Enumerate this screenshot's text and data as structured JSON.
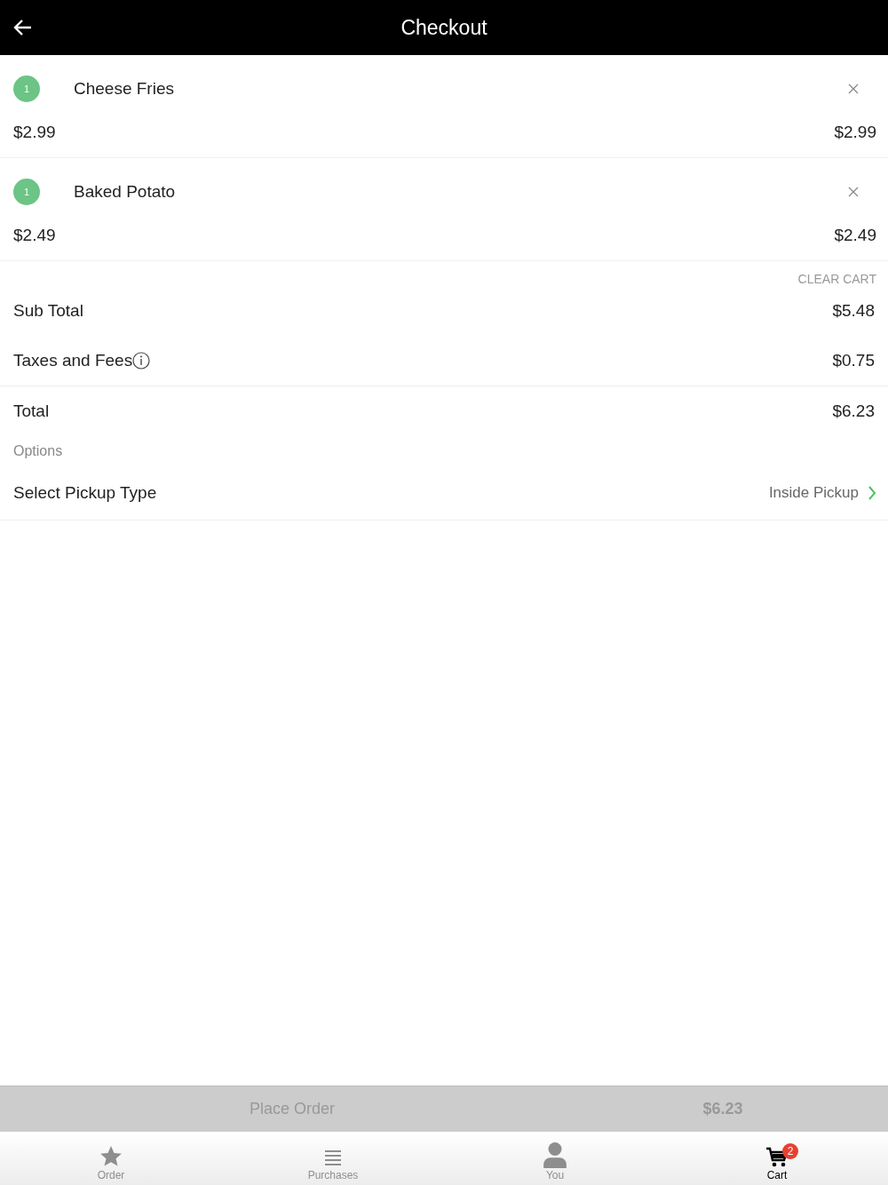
{
  "header": {
    "title": "Checkout"
  },
  "items": [
    {
      "quantity": "1",
      "name": "Cheese Fries",
      "unit_price": "$2.99",
      "line_total": "$2.99"
    },
    {
      "quantity": "1",
      "name": "Baked Potato",
      "unit_price": "$2.49",
      "line_total": "$2.49"
    }
  ],
  "clear_cart": "CLEAR CART",
  "summary": [
    {
      "label": "Sub Total",
      "value": "$5.48",
      "info": false,
      "divider_after": false
    },
    {
      "label": "Taxes and Fees",
      "value": "$0.75",
      "info": true,
      "divider_after": true
    },
    {
      "label": "Total",
      "value": "$6.23",
      "info": false,
      "divider_after": false
    }
  ],
  "options": {
    "heading": "Options",
    "label": "Select Pickup Type",
    "value": "Inside Pickup"
  },
  "place_order": {
    "label": "Place Order",
    "total": "$6.23",
    "disabled": true
  },
  "tabs": [
    {
      "kind": "star",
      "label": "Order",
      "selected": false
    },
    {
      "kind": "list",
      "label": "Purchases",
      "selected": false
    },
    {
      "kind": "person",
      "label": "You",
      "selected": false
    },
    {
      "kind": "cart",
      "label": "Cart",
      "selected": true,
      "badge": "2"
    }
  ]
}
